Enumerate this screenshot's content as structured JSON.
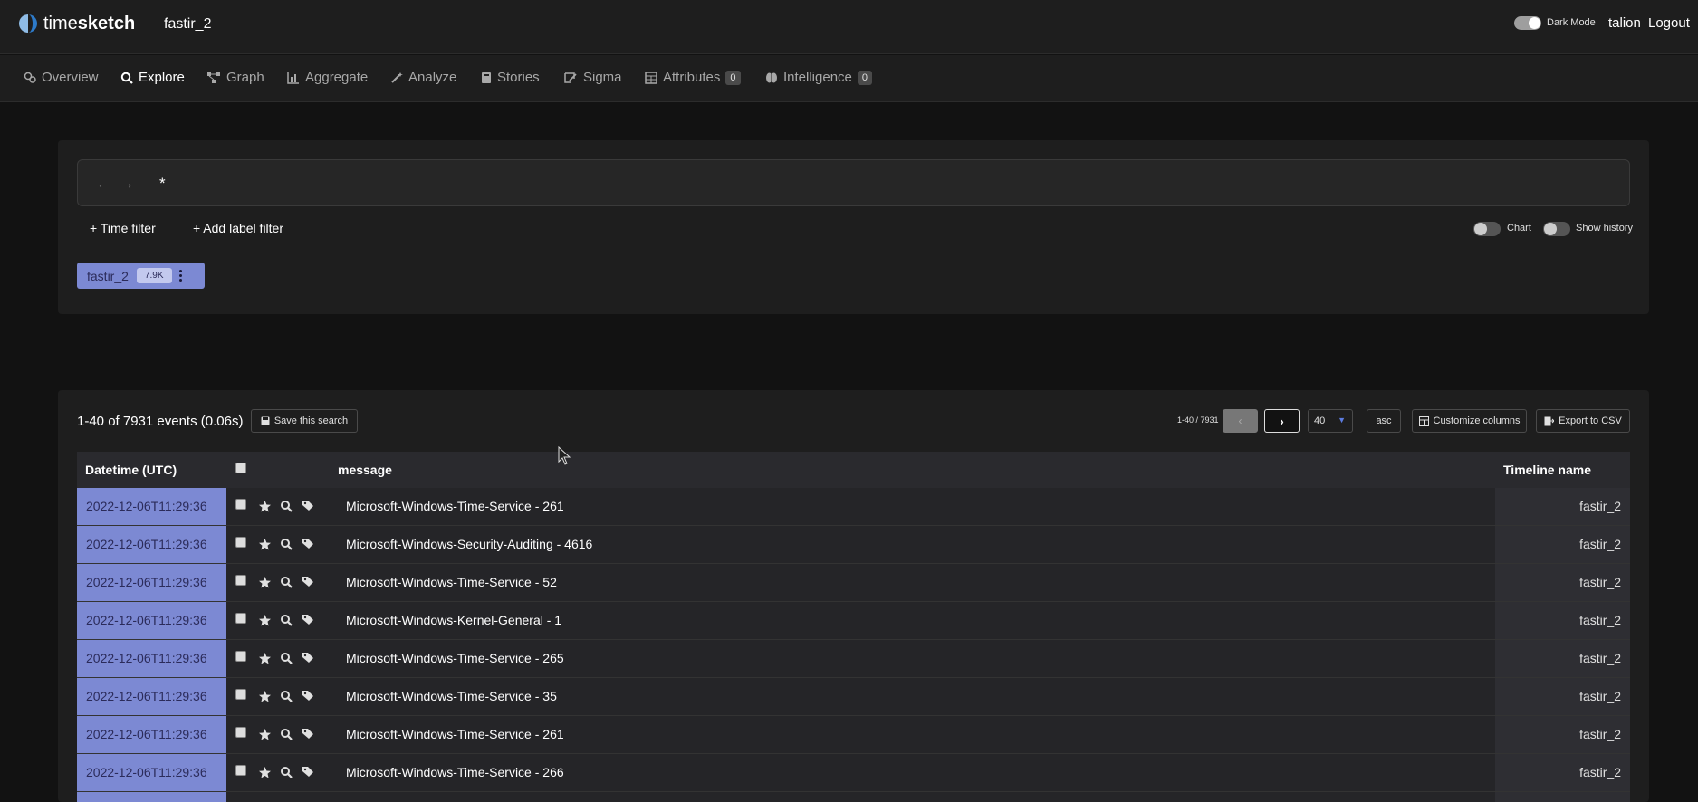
{
  "header": {
    "logo_light": "time",
    "logo_bold": "sketch",
    "sketch_name": "fastir_2",
    "dark_mode_label": "Dark Mode",
    "user": "talion",
    "logout": "Logout"
  },
  "nav": {
    "items": [
      {
        "label": "Overview",
        "icon": "overview-icon"
      },
      {
        "label": "Explore",
        "icon": "search-icon",
        "active": true
      },
      {
        "label": "Graph",
        "icon": "graph-icon"
      },
      {
        "label": "Aggregate",
        "icon": "chart-icon"
      },
      {
        "label": "Analyze",
        "icon": "magic-wand-icon"
      },
      {
        "label": "Stories",
        "icon": "book-icon"
      },
      {
        "label": "Sigma",
        "icon": "sigma-icon"
      },
      {
        "label": "Attributes",
        "icon": "table-icon",
        "badge": "0"
      },
      {
        "label": "Intelligence",
        "icon": "brain-icon",
        "badge": "0"
      }
    ]
  },
  "search": {
    "query": "*",
    "time_filter": "+ Time filter",
    "label_filter": "+ Add label filter",
    "chart_label": "Chart",
    "history_label": "Show history",
    "timeline_chip": {
      "name": "fastir_2",
      "count": "7.9K",
      "color": "#7c89d3"
    }
  },
  "events": {
    "summary": "1-40 of 7931 events (0.06s)",
    "save_search": "Save this search",
    "pager_label": "1-40 / 7931",
    "page_size": "40",
    "sort_order": "asc",
    "customize_columns": "Customize columns",
    "export_csv": "Export to CSV",
    "columns": {
      "datetime": "Datetime (UTC)",
      "message": "message",
      "timeline": "Timeline name"
    },
    "rows": [
      {
        "datetime": "2022-12-06T11:29:36",
        "message": "Microsoft-Windows-Time-Service - 261",
        "timeline": "fastir_2"
      },
      {
        "datetime": "2022-12-06T11:29:36",
        "message": "Microsoft-Windows-Security-Auditing - 4616",
        "timeline": "fastir_2"
      },
      {
        "datetime": "2022-12-06T11:29:36",
        "message": "Microsoft-Windows-Time-Service - 52",
        "timeline": "fastir_2"
      },
      {
        "datetime": "2022-12-06T11:29:36",
        "message": "Microsoft-Windows-Kernel-General - 1",
        "timeline": "fastir_2"
      },
      {
        "datetime": "2022-12-06T11:29:36",
        "message": "Microsoft-Windows-Time-Service - 265",
        "timeline": "fastir_2"
      },
      {
        "datetime": "2022-12-06T11:29:36",
        "message": "Microsoft-Windows-Time-Service - 35",
        "timeline": "fastir_2"
      },
      {
        "datetime": "2022-12-06T11:29:36",
        "message": "Microsoft-Windows-Time-Service - 261",
        "timeline": "fastir_2"
      },
      {
        "datetime": "2022-12-06T11:29:36",
        "message": "Microsoft-Windows-Time-Service - 266",
        "timeline": "fastir_2"
      },
      {
        "datetime": "",
        "message": "",
        "timeline": ""
      }
    ]
  },
  "colors": {
    "accent": "#7c89d3",
    "background": "#121212",
    "card": "#1e1e1e"
  }
}
